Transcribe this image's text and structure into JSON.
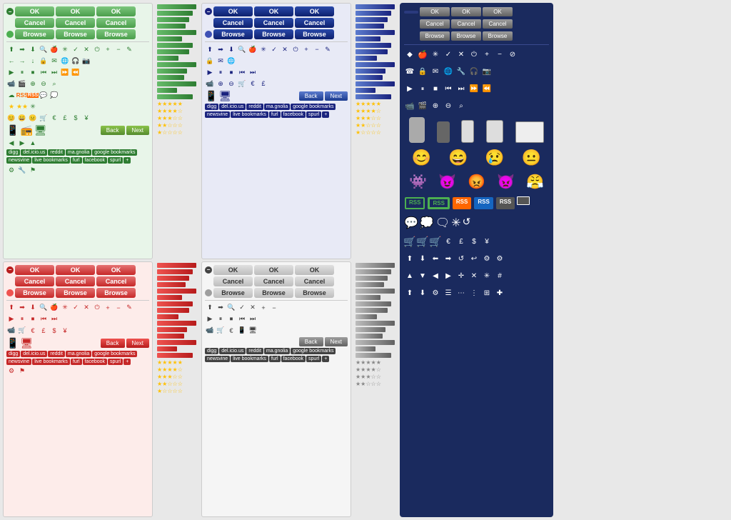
{
  "colors": {
    "green": "#2e7d32",
    "red": "#c62828",
    "blue": "#1a237e",
    "darkbg": "#1a2a5e",
    "orange": "#ff6600",
    "gold": "#ffc107"
  },
  "buttons": {
    "ok": "OK",
    "cancel": "Cancel",
    "browse": "Browse",
    "back": "Back",
    "next": "Next"
  },
  "social": {
    "items": [
      "digg",
      "del.icio.us",
      "reddit",
      "ma.gnolia",
      "google bookmarks",
      "newsvine",
      "live bookmarks",
      "furl",
      "facebook",
      "spurl",
      "+"
    ]
  },
  "panels": {
    "green": "green theme",
    "red": "red theme",
    "blue": "blue theme",
    "dark": "dark theme"
  }
}
